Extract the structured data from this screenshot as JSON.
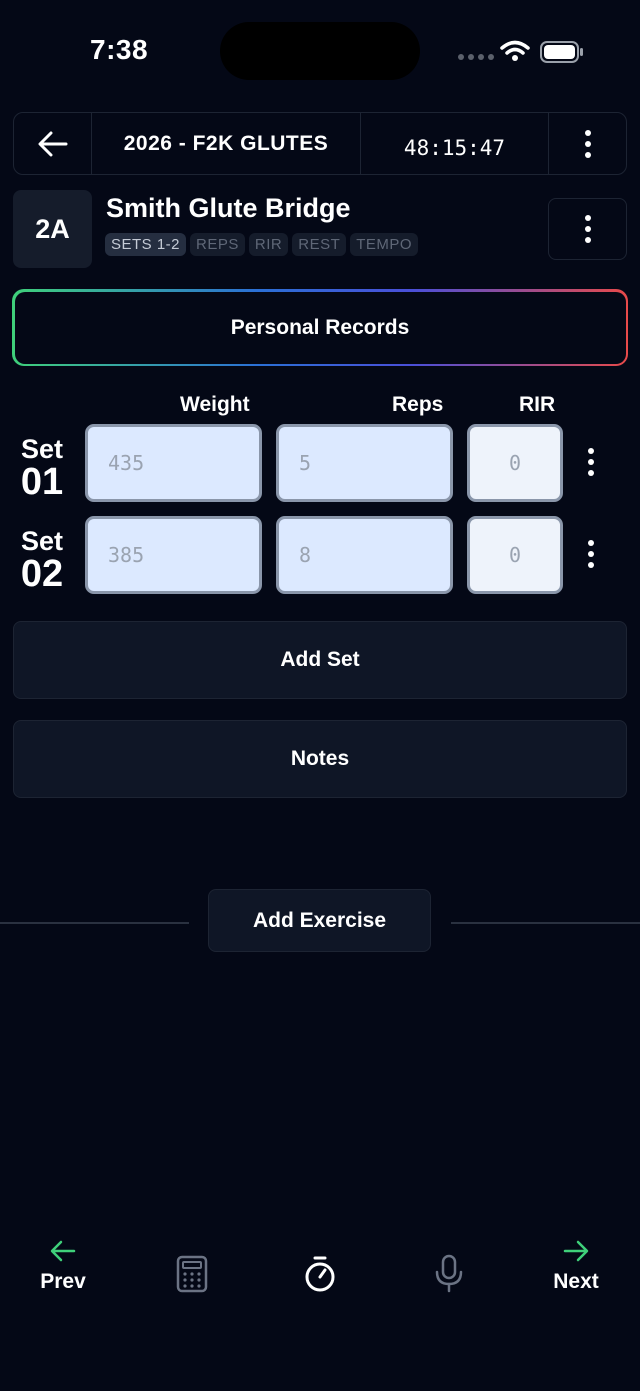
{
  "status_bar": {
    "time": "7:38"
  },
  "header": {
    "title": "2026 - F2K GLUTES",
    "timer": "48:15:47"
  },
  "exercise": {
    "badge": "2A",
    "name": "Smith Glute Bridge",
    "tags": [
      "SETS 1-2",
      "REPS",
      "RIR",
      "REST",
      "TEMPO"
    ]
  },
  "personal_records_label": "Personal Records",
  "columns": {
    "weight": "Weight",
    "reps": "Reps",
    "rir": "RIR"
  },
  "sets": [
    {
      "label": "Set",
      "number": "01",
      "weight_placeholder": "435",
      "reps_placeholder": "5",
      "rir_placeholder": "0"
    },
    {
      "label": "Set",
      "number": "02",
      "weight_placeholder": "385",
      "reps_placeholder": "8",
      "rir_placeholder": "0"
    }
  ],
  "buttons": {
    "add_set": "Add Set",
    "notes": "Notes",
    "add_exercise": "Add Exercise"
  },
  "bottom_nav": {
    "prev": "Prev",
    "next": "Next"
  },
  "icons": {
    "back": "arrow-left-icon",
    "menu": "kebab-menu-icon",
    "calculator": "calculator-icon",
    "timer": "stopwatch-icon",
    "mic": "microphone-icon",
    "prev": "arrow-left-icon",
    "next": "arrow-right-icon"
  },
  "colors": {
    "background": "#040816",
    "accent_green": "#3fd07a",
    "accent_red": "#e84a4a",
    "field_bg": "#dce9ff"
  }
}
